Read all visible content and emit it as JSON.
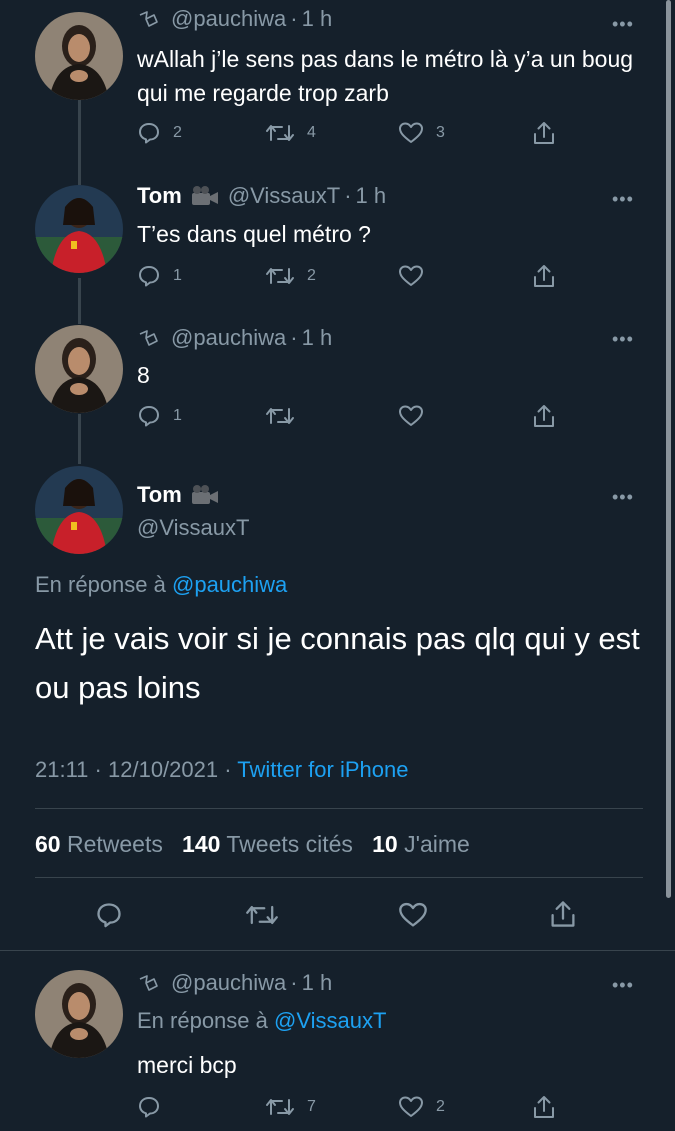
{
  "tweets": [
    {
      "handle": "@pauchiwa",
      "time": "1 h",
      "text": "wAllah j’le sens pas dans le métro là y’a un boug qui me regarde trop zarb",
      "replies": "2",
      "retweets": "4",
      "likes": "3"
    },
    {
      "name": "Tom",
      "handle": "@VissauxT",
      "time": "1 h",
      "text": "T’es dans quel métro ?",
      "replies": "1",
      "retweets": "2",
      "likes": ""
    },
    {
      "handle": "@pauchiwa",
      "time": "1 h",
      "text": "8",
      "replies": "1",
      "retweets": "",
      "likes": ""
    }
  ],
  "main_tweet": {
    "name": "Tom",
    "handle": "@VissauxT",
    "reply_prefix": "En réponse à",
    "reply_to": "@pauchiwa",
    "text": "Att je vais voir si je connais pas qlq qui y est ou pas loins",
    "time": "21:11",
    "date": "12/10/2021",
    "source": "Twitter for iPhone",
    "retweets_count": "60",
    "retweets_label": "Retweets",
    "quotes_count": "140",
    "quotes_label": "Tweets cités",
    "likes_count": "10",
    "likes_label": "J'aime"
  },
  "reply_tweet": {
    "handle": "@pauchiwa",
    "time": "1 h",
    "reply_prefix": "En réponse à",
    "reply_to": "@VissauxT",
    "text": "merci bcp",
    "replies": "",
    "retweets": "7",
    "likes": "2"
  },
  "separator": "·",
  "more_glyph": "•••",
  "icons": {
    "reply": "reply-icon",
    "retweet": "retweet-icon",
    "like": "heart-icon",
    "share": "share-icon",
    "locked": "lock-icon",
    "camera": "movie-camera-icon"
  },
  "colors": {
    "background": "#15202b",
    "text": "#ffffff",
    "secondary": "#8899a6",
    "link": "#1da1f2",
    "divider": "#38444d"
  }
}
